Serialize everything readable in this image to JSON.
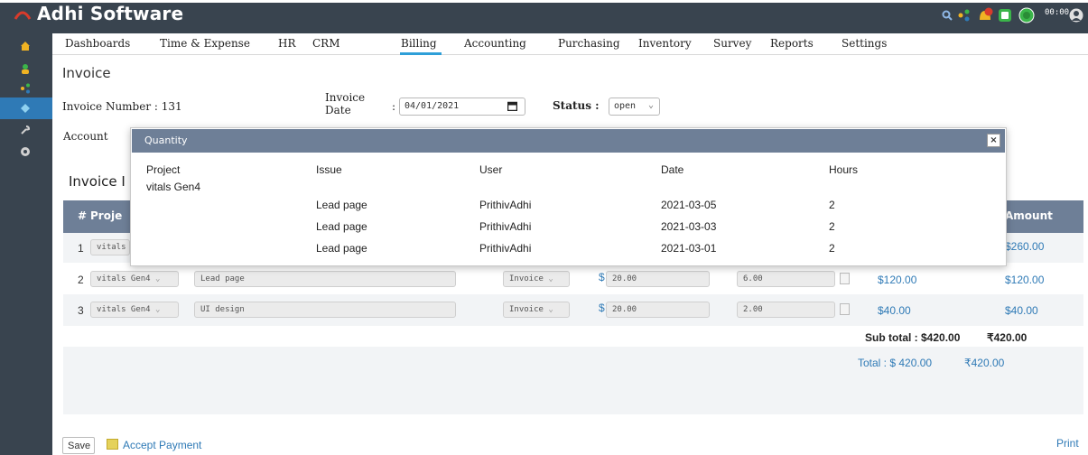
{
  "app": {
    "title": "Adhi Software",
    "clock": "00:00",
    "notification_count": "64"
  },
  "nav": {
    "items": [
      "Dashboards",
      "Time & Expense",
      "HR",
      "CRM",
      "Billing",
      "Accounting",
      "Purchasing",
      "Inventory",
      "Survey",
      "Reports",
      "Settings"
    ],
    "active": "Billing"
  },
  "page": {
    "title": "Invoice",
    "invoice_number_label": "Invoice Number : 131",
    "invoice_date_label": "Invoice Date",
    "invoice_date_sep": ":",
    "invoice_date_value": "04/01/2021",
    "status_label": "Status :",
    "status_value": "open",
    "account_label": "Account",
    "section_title_partial": "Invoice I"
  },
  "table": {
    "header_num": "#",
    "header_project_partial": "Proje",
    "header_amount": "Amount",
    "rows": [
      {
        "num": "1",
        "project": "vitals",
        "amount": "$260.00"
      },
      {
        "num": "2",
        "project": "vitals Gen4",
        "issue": "Lead page",
        "type": "Invoice",
        "rate_sym": "$",
        "rate": "20.00",
        "hours": "6.00",
        "total": "$120.00",
        "amount": "$120.00"
      },
      {
        "num": "3",
        "project": "vitals Gen4",
        "issue": "UI design",
        "type": "Invoice",
        "rate_sym": "$",
        "rate": "20.00",
        "hours": "2.00",
        "total": "$40.00",
        "amount": "$40.00"
      }
    ],
    "subtotal": "Sub total : $420.00",
    "subtotal_inr": "₹420.00",
    "total": "Total : $ 420.00",
    "total_inr": "₹420.00"
  },
  "modal": {
    "title": "Quantity",
    "close_label": "×",
    "columns": [
      "Project",
      "Issue",
      "User",
      "Date",
      "Hours"
    ],
    "project": "vitals Gen4",
    "rows": [
      {
        "issue": "Lead page",
        "user": "PrithivAdhi",
        "date": "2021-03-05",
        "hours": "2"
      },
      {
        "issue": "Lead page",
        "user": "PrithivAdhi",
        "date": "2021-03-03",
        "hours": "2"
      },
      {
        "issue": "Lead page",
        "user": "PrithivAdhi",
        "date": "2021-03-01",
        "hours": "2"
      }
    ]
  },
  "footer": {
    "save_label": "Save",
    "accept_payment_label": "Accept Payment",
    "print_label": "Print"
  },
  "colors": {
    "header_bg": "#39444f",
    "accent": "#2f7ab6",
    "table_header": "#6e7f97"
  }
}
